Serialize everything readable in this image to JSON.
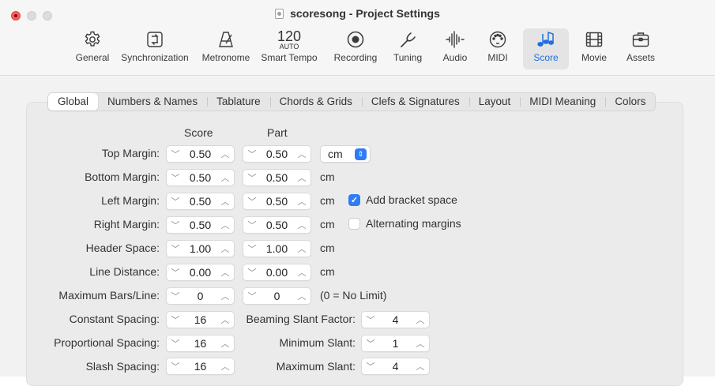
{
  "window": {
    "title": "scoresong - Project Settings"
  },
  "toolbar": [
    {
      "key": "general",
      "label": "General",
      "icon": "gear-icon"
    },
    {
      "key": "synchronization",
      "label": "Synchronization",
      "icon": "sync-icon"
    },
    {
      "key": "metronome",
      "label": "Metronome",
      "icon": "metronome-icon"
    },
    {
      "key": "smart-tempo",
      "label": "Smart Tempo",
      "icon": "tempo-icon",
      "tempo": "120",
      "tempo_mode": "AUTO"
    },
    {
      "key": "recording",
      "label": "Recording",
      "icon": "record-icon"
    },
    {
      "key": "tuning",
      "label": "Tuning",
      "icon": "tuning-fork-icon"
    },
    {
      "key": "audio",
      "label": "Audio",
      "icon": "waveform-icon"
    },
    {
      "key": "midi",
      "label": "MIDI",
      "icon": "midi-port-icon"
    },
    {
      "key": "score",
      "label": "Score",
      "icon": "music-notes-icon",
      "active": true
    },
    {
      "key": "movie",
      "label": "Movie",
      "icon": "film-icon"
    },
    {
      "key": "assets",
      "label": "Assets",
      "icon": "briefcase-icon"
    }
  ],
  "tabs": [
    "Global",
    "Numbers & Names",
    "Tablature",
    "Chords & Grids",
    "Clefs & Signatures",
    "Layout",
    "MIDI Meaning",
    "Colors"
  ],
  "active_tab": "Global",
  "columns": {
    "score": "Score",
    "part": "Part"
  },
  "margins": [
    {
      "label": "Top Margin:",
      "score": "0.50",
      "part": "0.50",
      "unit": "cm"
    },
    {
      "label": "Bottom Margin:",
      "score": "0.50",
      "part": "0.50",
      "unit": "cm"
    },
    {
      "label": "Left Margin:",
      "score": "0.50",
      "part": "0.50",
      "unit": "cm"
    },
    {
      "label": "Right Margin:",
      "score": "0.50",
      "part": "0.50",
      "unit": "cm"
    },
    {
      "label": "Header Space:",
      "score": "1.00",
      "part": "1.00",
      "unit": "cm"
    },
    {
      "label": "Line Distance:",
      "score": "0.00",
      "part": "0.00",
      "unit": "cm"
    },
    {
      "label": "Maximum Bars/Line:",
      "score": "0",
      "part": "0",
      "unit": "(0 = No Limit)"
    }
  ],
  "unit_select": {
    "value": "cm"
  },
  "checkboxes": {
    "add_bracket_space": {
      "label": "Add bracket space",
      "checked": true
    },
    "alternating_margins": {
      "label": "Alternating margins",
      "checked": false
    }
  },
  "spacing": [
    {
      "label": "Constant Spacing:",
      "value": "16"
    },
    {
      "label": "Proportional Spacing:",
      "value": "16"
    },
    {
      "label": "Slash Spacing:",
      "value": "16"
    }
  ],
  "slant": [
    {
      "label": "Beaming Slant Factor:",
      "value": "4"
    },
    {
      "label": "Minimum Slant:",
      "value": "1"
    },
    {
      "label": "Maximum Slant:",
      "value": "4"
    }
  ],
  "colors": {
    "accent": "#2f7cf6",
    "close": "#ff5f57"
  }
}
